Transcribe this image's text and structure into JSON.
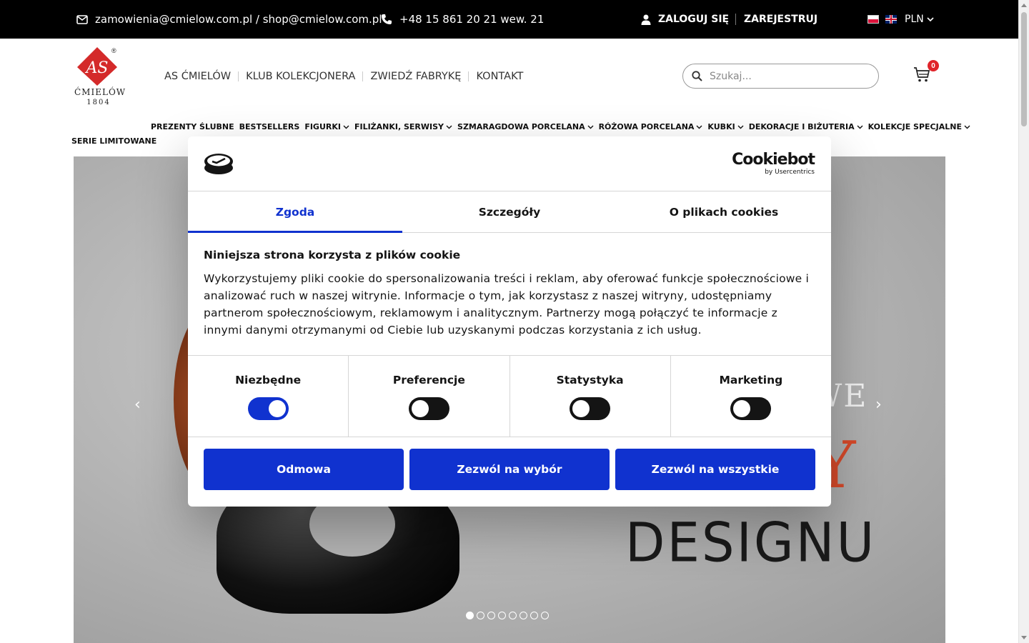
{
  "topbar": {
    "email": "zamowienia@cmielow.com.pl / shop@cmielow.com.pl",
    "phone": "+48 15 861 20 21 wew. 21",
    "login": "ZALOGUJ SIĘ",
    "register": "ZAREJESTRUJ",
    "currency": "PLN"
  },
  "logo": {
    "brand": "ĆMIELÓW",
    "year": "1804",
    "mark": "AS",
    "registered": "®"
  },
  "mainnav": [
    "AS ĆMIELÓW",
    "KLUB KOLEKCJONERA",
    "ZWIEDŹ FABRYKĘ",
    "KONTAKT"
  ],
  "search": {
    "placeholder": "Szukaj..."
  },
  "cart": {
    "count": "0"
  },
  "catnav": [
    {
      "label": "PREZENTY ŚLUBNE",
      "dropdown": false
    },
    {
      "label": "BESTSELLERS",
      "dropdown": false
    },
    {
      "label": "FIGURKI",
      "dropdown": true
    },
    {
      "label": "FILIŻANKI, SERWISY",
      "dropdown": true
    },
    {
      "label": "SZMARAGDOWA PORCELANA",
      "dropdown": true
    },
    {
      "label": "RÓŻOWA PORCELANA",
      "dropdown": true
    },
    {
      "label": "KUBKI",
      "dropdown": true
    },
    {
      "label": "DEKORACJE I BIŻUTERIA",
      "dropdown": true
    },
    {
      "label": "KOLEKCJE SPECJALNE",
      "dropdown": true
    }
  ],
  "catnav_second_row": "SERIE LIMITOWANE",
  "hero": {
    "text_partial": "WE",
    "text_partial2": "Y",
    "text_main": "DESIGNU",
    "slide_count": 8,
    "active_slide": 1
  },
  "cookie": {
    "brand": "Cookiebot",
    "brand_sub": "by Usercentrics",
    "tabs": [
      "Zgoda",
      "Szczegóły",
      "O plikach cookies"
    ],
    "active_tab": "Zgoda",
    "heading": "Niniejsza strona korzysta z plików cookie",
    "body": "Wykorzystujemy pliki cookie do spersonalizowania treści i reklam, aby oferować funkcje społecznościowe i analizować ruch w naszej witrynie. Informacje o tym, jak korzystasz z naszej witryny, udostępniamy partnerom społecznościowym, reklamowym i analitycznym. Partnerzy mogą połączyć te informacje z innymi danymi otrzymanymi od Ciebie lub uzyskanymi podczas korzystania z ich usług.",
    "toggles": [
      {
        "label": "Niezbędne",
        "on": true
      },
      {
        "label": "Preferencje",
        "on": false
      },
      {
        "label": "Statystyka",
        "on": false
      },
      {
        "label": "Marketing",
        "on": false
      }
    ],
    "buttons": [
      "Odmowa",
      "Zezwól na wybór",
      "Zezwól na wszystkie"
    ]
  },
  "colors": {
    "accent": "#1032cf",
    "brand_red": "#e0242a",
    "topbar": "#000000"
  }
}
